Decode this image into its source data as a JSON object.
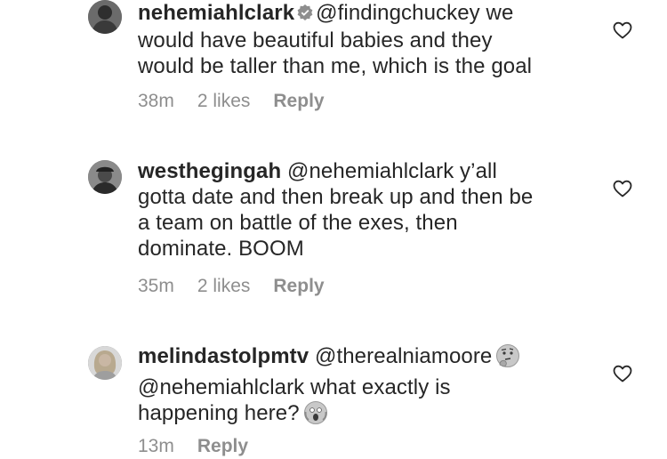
{
  "comments": [
    {
      "username": "nehemiahlclark",
      "verified": true,
      "text_lines": [
        "@findingchuckey we",
        "would have beautiful babies and they",
        "would be taller than me, which is the goal"
      ],
      "time": "38m",
      "likes": "2 likes",
      "reply_label": "Reply",
      "avatar_icon": "profile-photo-man"
    },
    {
      "username": "westhegingah",
      "verified": false,
      "text_lines": [
        "@nehemiahlclark y’all",
        "gotta date and then break up and then be",
        "a team on battle of the exes, then",
        "dominate. BOOM"
      ],
      "time": "35m",
      "likes": "2 likes",
      "reply_label": "Reply",
      "avatar_icon": "profile-photo-man-cap"
    },
    {
      "username": "melindastolpmtv",
      "verified": false,
      "text_lines": [
        "@therealniamoore",
        "@nehemiahlclark what exactly is",
        "happening here?"
      ],
      "emojis": [
        "thinking-face-emoji",
        "screaming-face-emoji"
      ],
      "time": "13m",
      "reply_label": "Reply",
      "avatar_icon": "profile-photo-woman-blonde"
    }
  ],
  "colors": {
    "text": "#262626",
    "meta": "#8e8e8e",
    "verified_badge": "#8e8e8e"
  }
}
